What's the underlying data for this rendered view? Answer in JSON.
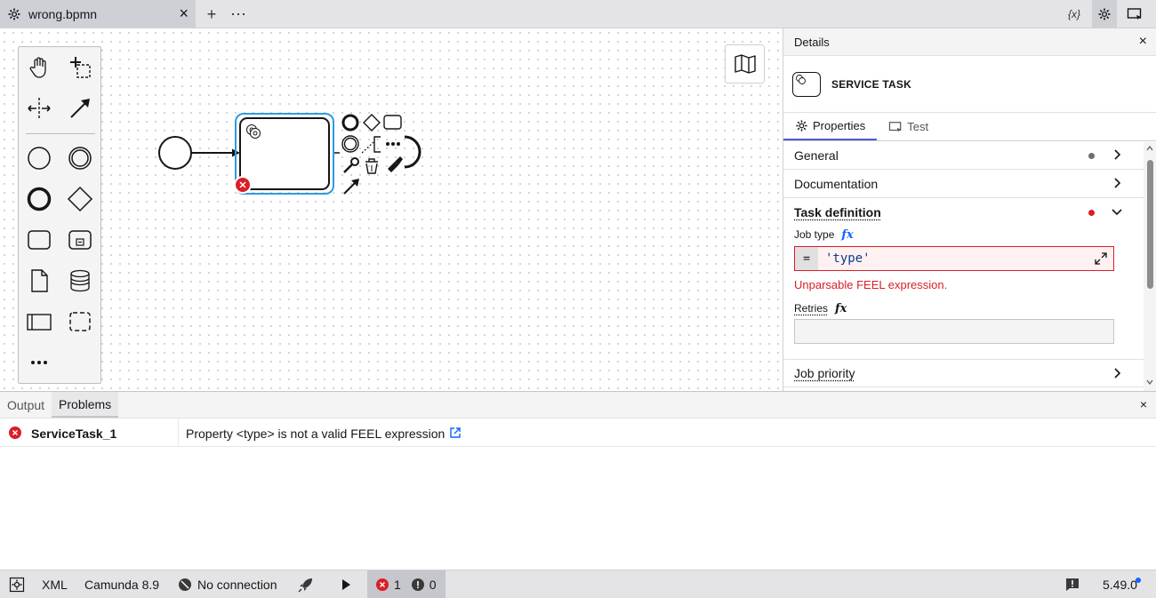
{
  "tab": {
    "title": "wrong.bpmn",
    "close": "×"
  },
  "toolbar": {
    "add": "+",
    "more": "⋯",
    "variables": "{x}"
  },
  "details": {
    "title": "Details",
    "close": "×",
    "element_type": "SERVICE TASK",
    "tabs": [
      "Properties",
      "Test"
    ],
    "groups": {
      "general": "General",
      "documentation": "Documentation",
      "task_definition": "Task definition",
      "job_priority": "Job priority"
    },
    "fields": {
      "job_type_label": "Job type",
      "fx": "fx",
      "eq": "=",
      "job_type_value": "'type'",
      "job_type_error": "Unparsable FEEL expression.",
      "retries_label": "Retries",
      "retries_value": ""
    },
    "colors": {
      "error": "#da1e28",
      "gray_dot": "#6f6f6f",
      "accent": "#4d5bd1"
    }
  },
  "bottom": {
    "tabs": [
      "Output",
      "Problems"
    ],
    "active_tab": "Problems",
    "close": "×",
    "problems": [
      {
        "element": "ServiceTask_1",
        "message": "Property <type> is not a valid FEEL expression"
      }
    ]
  },
  "status": {
    "xml": "XML",
    "platform": "Camunda 8.9",
    "connection": "No connection",
    "errors": "1",
    "warnings": "0",
    "version": "5.49.0"
  }
}
